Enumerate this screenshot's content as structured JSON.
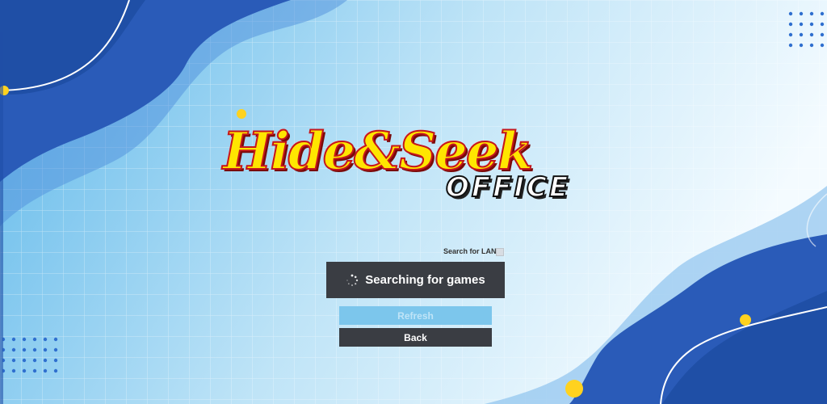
{
  "logo": {
    "title": "Hide&Seek",
    "subtitle": "OFFICE"
  },
  "lobby": {
    "search_lan_label": "Search for LAN",
    "search_lan_checked": false,
    "status_text": "Searching for games",
    "refresh_label": "Refresh",
    "refresh_enabled": false,
    "back_label": "Back"
  },
  "icons": {
    "status": "loading-spinner-icon"
  },
  "colors": {
    "dark_blue": "#1f4fa6",
    "light_blue": "#5fb8ea",
    "panel_dark": "#3a3d43",
    "accent_yellow": "#ffd21f",
    "logo_yellow": "#ffe600",
    "logo_red": "#c4161c"
  }
}
